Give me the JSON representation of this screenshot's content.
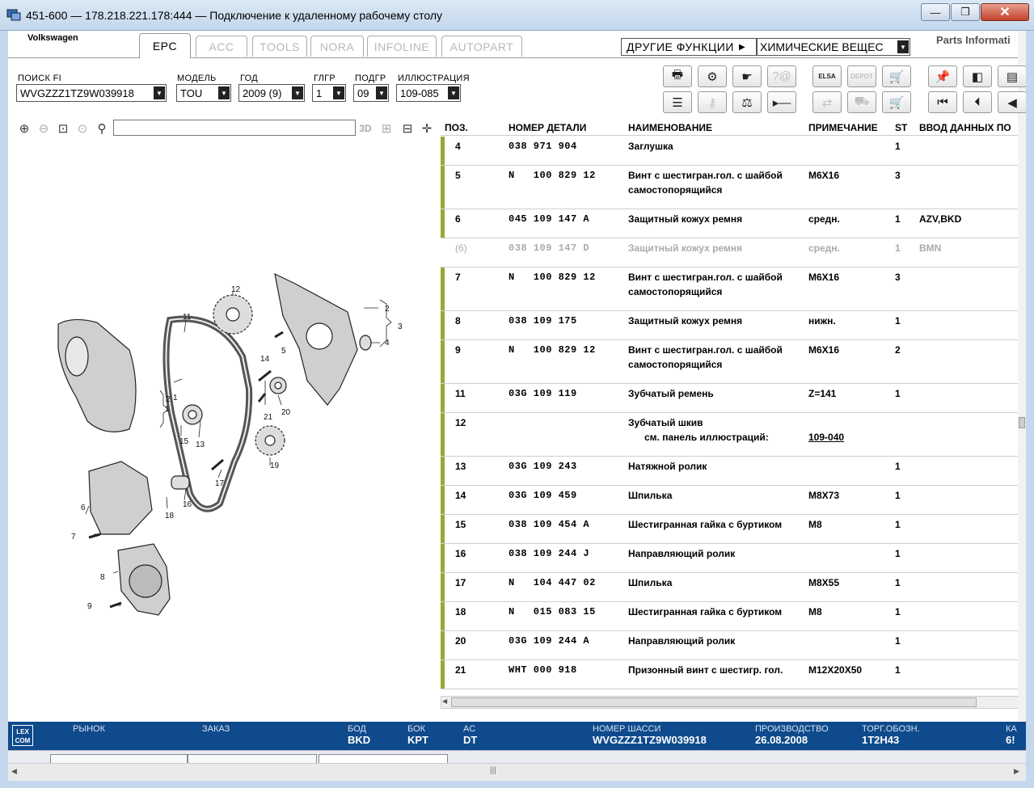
{
  "window": {
    "title": "451-600 — 178.218.221.178:444 — Подключение к удаленному рабочему столу",
    "minimize_label": "—",
    "maximize_label": "❐",
    "close_label": "✕"
  },
  "header": {
    "brand": "Volkswagen",
    "tabs": [
      {
        "label": "EPC",
        "active": true
      },
      {
        "label": "ACC",
        "active": false
      },
      {
        "label": "TOOLS",
        "active": false
      },
      {
        "label": "NORA",
        "active": false
      },
      {
        "label": "INFOLINE",
        "active": false
      },
      {
        "label": "AUTOPART",
        "active": false
      }
    ],
    "other_functions_label": "ДРУГИЕ ФУНКЦИИ",
    "chem_select_value": "ХИМИЧЕСКИЕ ВЕЩЕС",
    "parts_info": "Parts Informati"
  },
  "fields": {
    "fi_search": {
      "label": "ПОИСК FI",
      "value": "WVGZZZ1TZ9W039918"
    },
    "model": {
      "label": "МОДЕЛЬ",
      "value": "TOU"
    },
    "year": {
      "label": "ГОД",
      "value": "2009 (9)"
    },
    "glgr": {
      "label": "ГЛГР",
      "value": "1"
    },
    "podgr": {
      "label": "ПОДГР",
      "value": "09"
    },
    "illustration": {
      "label": "ИЛЛЮСТРАЦИЯ",
      "value": "109-085"
    }
  },
  "toolbar": {
    "row1": [
      {
        "name": "print-icon",
        "glyph": "🖶",
        "enabled": true
      },
      {
        "name": "part-search-icon",
        "glyph": "⚙",
        "enabled": true
      },
      {
        "name": "hand-icon",
        "glyph": "☛",
        "enabled": true
      },
      {
        "name": "help-icon",
        "glyph": "?@",
        "enabled": false
      },
      {
        "name": "elsa-icon",
        "glyph": "ELSA",
        "enabled": true
      },
      {
        "name": "depot-icon",
        "glyph": "DEPOT",
        "enabled": false
      },
      {
        "name": "cart-icon",
        "glyph": "🛒",
        "enabled": true
      },
      {
        "name": "pin-icon",
        "glyph": "📌",
        "enabled": true
      },
      {
        "name": "page-back-icon",
        "glyph": "◧",
        "enabled": true
      },
      {
        "name": "page-icon",
        "glyph": "▤",
        "enabled": true
      }
    ],
    "row2": [
      {
        "name": "list-icon",
        "glyph": "☰",
        "enabled": true
      },
      {
        "name": "key-icon",
        "glyph": "⚷",
        "enabled": false
      },
      {
        "name": "scale-icon",
        "glyph": "⚖",
        "enabled": true
      },
      {
        "name": "play-icon",
        "glyph": "▸—",
        "enabled": true
      },
      {
        "name": "transfer-icon",
        "glyph": "⇄",
        "enabled": false
      },
      {
        "name": "car-icon",
        "glyph": "⛟",
        "enabled": false
      },
      {
        "name": "cart-add-icon",
        "glyph": "🛒",
        "enabled": true
      },
      {
        "name": "first-icon",
        "glyph": "⏮",
        "enabled": true
      },
      {
        "name": "prev-icon",
        "glyph": "⏴",
        "enabled": true
      },
      {
        "name": "back-icon",
        "glyph": "◀",
        "enabled": true
      }
    ]
  },
  "diagram_toolbar": {
    "zoom_in": "⊕",
    "zoom_out": "⊖",
    "zoom_fit": "⊡",
    "zoom_orig": "⊙",
    "search": "⚲",
    "label_3d": "3D"
  },
  "diagram_labels": [
    "1",
    "2",
    "3",
    "4",
    "5",
    "6",
    "7",
    "8",
    "9",
    "11",
    "12",
    "13",
    "14",
    "15",
    "16",
    "17",
    "18",
    "19",
    "20",
    "21",
    "2",
    "1"
  ],
  "table": {
    "headers": {
      "pos": "ПОЗ.",
      "part_number": "НОМЕР ДЕТАЛИ",
      "name": "НАИМЕНОВАНИЕ",
      "note": "ПРИМЕЧАНИЕ",
      "st": "ST",
      "data_entry": "ВВОД ДАННЫХ ПО"
    },
    "rows": [
      {
        "pos": "4",
        "pn": "038 971 904",
        "name": "Заглушка",
        "name2": "",
        "note": "",
        "st": "1",
        "extra": "",
        "grey": false,
        "h": 36
      },
      {
        "pos": "5",
        "pn": "N   100 829 12",
        "name": "Винт с шестигран.гол. с шайбой",
        "name2": "самостопорящийся",
        "note": "M6X16",
        "st": "3",
        "extra": "",
        "grey": false,
        "h": 54
      },
      {
        "pos": "6",
        "pn": "045 109 147 A",
        "name": "Защитный кожух ремня",
        "name2": "",
        "note": "средн.",
        "st": "1",
        "extra": "AZV,BKD",
        "grey": false,
        "h": 36
      },
      {
        "pos": "(6)",
        "pn": "038 109 147 D",
        "name": "Защитный кожух ремня",
        "name2": "",
        "note": "средн.",
        "st": "1",
        "extra": "BMN",
        "grey": true,
        "h": 36
      },
      {
        "pos": "7",
        "pn": "N   100 829 12",
        "name": "Винт с шестигран.гол. с шайбой",
        "name2": "самостопорящийся",
        "note": "M6X16",
        "st": "3",
        "extra": "",
        "grey": false,
        "h": 54
      },
      {
        "pos": "8",
        "pn": "038 109 175",
        "name": "Защитный кожух ремня",
        "name2": "",
        "note": "нижн.",
        "st": "1",
        "extra": "",
        "grey": false,
        "h": 36
      },
      {
        "pos": "9",
        "pn": "N   100 829 12",
        "name": "Винт с шестигран.гол. с шайбой",
        "name2": "самостопорящийся",
        "note": "M6X16",
        "st": "2",
        "extra": "",
        "grey": false,
        "h": 54
      },
      {
        "pos": "11",
        "pn": "03G 109 119",
        "name": "Зубчатый ремень",
        "name2": "",
        "note": "Z=141",
        "st": "1",
        "extra": "",
        "grey": false,
        "h": 36
      },
      {
        "pos": "12",
        "pn": "",
        "name": "Зубчатый шкив",
        "name2": "      см. панель иллюстраций:",
        "note": "",
        "note2": "109-040",
        "st": "",
        "extra": "",
        "grey": false,
        "h": 54
      },
      {
        "pos": "13",
        "pn": "03G 109 243",
        "name": "Натяжной ролик",
        "name2": "",
        "note": "",
        "st": "1",
        "extra": "",
        "grey": false,
        "h": 36
      },
      {
        "pos": "14",
        "pn": "03G 109 459",
        "name": "Шпилька",
        "name2": "",
        "note": "M8X73",
        "st": "1",
        "extra": "",
        "grey": false,
        "h": 36
      },
      {
        "pos": "15",
        "pn": "038 109 454 A",
        "name": "Шестигранная гайка с буртиком",
        "name2": "",
        "note": "M8",
        "st": "1",
        "extra": "",
        "grey": false,
        "h": 36
      },
      {
        "pos": "16",
        "pn": "038 109 244 J",
        "name": "Направляющий ролик",
        "name2": "",
        "note": "",
        "st": "1",
        "extra": "",
        "grey": false,
        "h": 36
      },
      {
        "pos": "17",
        "pn": "N   104 447 02",
        "name": "Шпилька",
        "name2": "",
        "note": "M8X55",
        "st": "1",
        "extra": "",
        "grey": false,
        "h": 36
      },
      {
        "pos": "18",
        "pn": "N   015 083 15",
        "name": "Шестигранная гайка с буртиком",
        "name2": "",
        "note": "M8",
        "st": "1",
        "extra": "",
        "grey": false,
        "h": 36
      },
      {
        "pos": "20",
        "pn": "03G 109 244 A",
        "name": "Направляющий ролик",
        "name2": "",
        "note": "",
        "st": "1",
        "extra": "",
        "grey": false,
        "h": 36
      },
      {
        "pos": "21",
        "pn": "WHT 000 918",
        "name": "Призонный винт с шестигр. гол.",
        "name2": "",
        "note": "M12X20X50",
        "st": "1",
        "extra": "",
        "grey": false,
        "h": 36
      }
    ]
  },
  "statusbar": {
    "logo": "LEX COM",
    "market_label": "РЫНОК",
    "order_label": "ЗАКАЗ",
    "bod_label": "БОД",
    "bod_value": "BKD",
    "bok_label": "БОК",
    "bok_value": "KPT",
    "ac_label": "AC",
    "ac_value": "DT",
    "chassis_label": "НОМЕР ШАССИ",
    "chassis_value": "WVGZZZ1TZ9W039918",
    "production_label": "ПРОИЗВОДСТВО",
    "production_value": "26.08.2008",
    "trade_label": "ТОРГ.ОБОЗН.",
    "trade_value": "1T2H43",
    "ka_label": "КА",
    "ka_value": "6!"
  },
  "colors": {
    "row_marker": "#99a834",
    "statusbar_bg": "#0f4a8c",
    "title_bg": "#c4d7ec"
  }
}
